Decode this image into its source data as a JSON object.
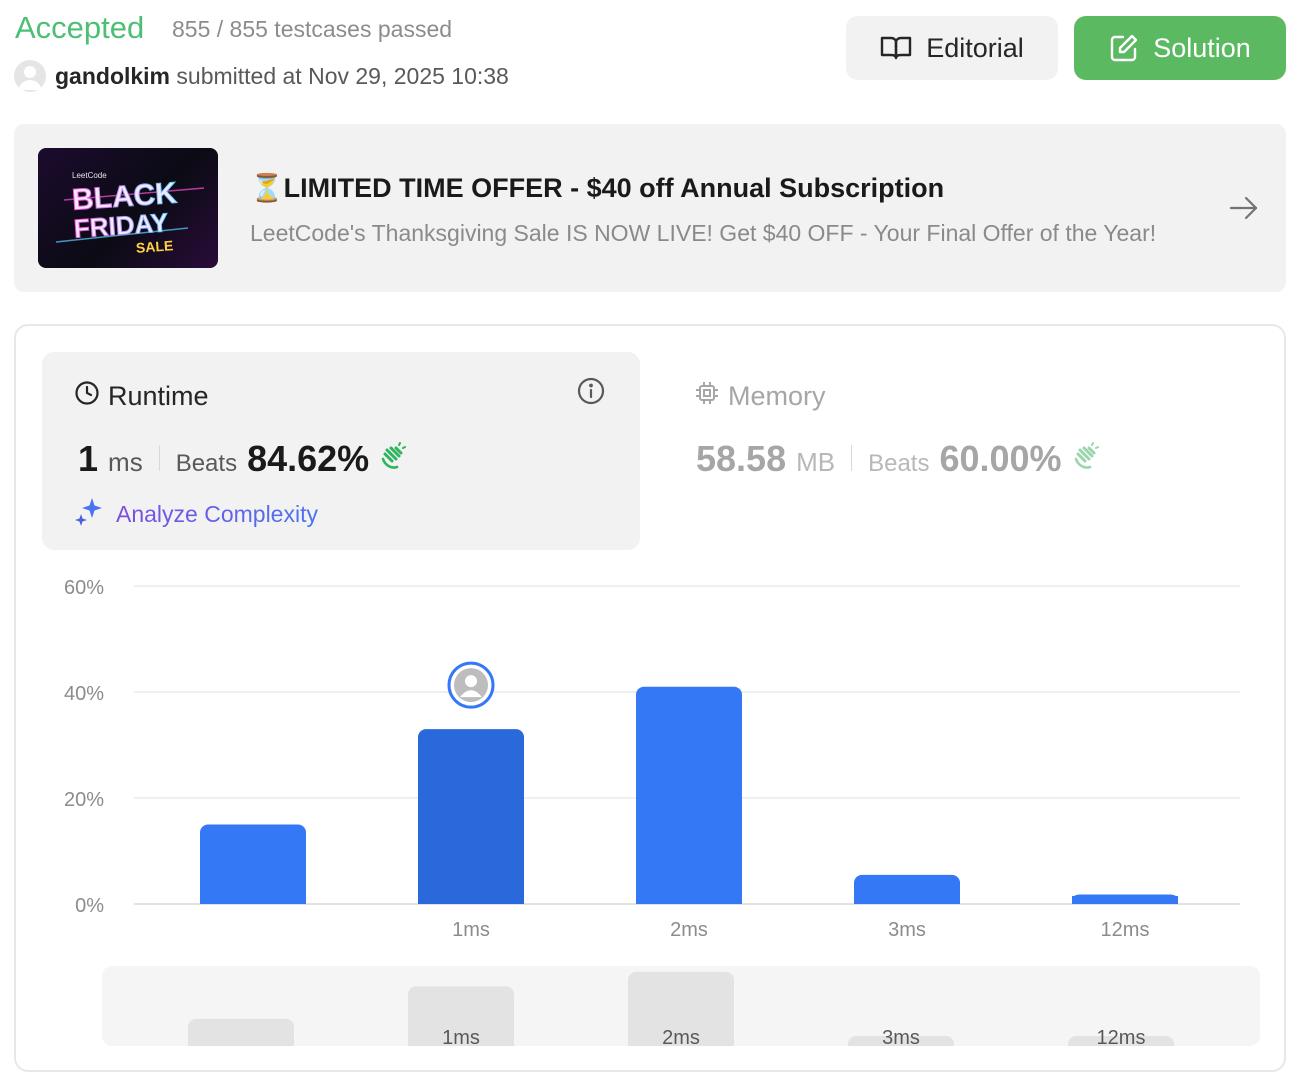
{
  "submission": {
    "status": "Accepted",
    "testcases": "855 / 855 testcases passed",
    "username": "gandolkim",
    "submitted_text": "submitted at Nov 29, 2025 10:38"
  },
  "actions": {
    "editorial_label": "Editorial",
    "solution_label": "Solution"
  },
  "promo": {
    "image_logo": "LeetCode",
    "image_line1": "BLACK",
    "image_line2": "FRIDAY",
    "image_line3": "SALE",
    "title": "⏳LIMITED TIME OFFER - $40 off Annual Subscription",
    "subtitle": "LeetCode's Thanksgiving Sale IS NOW LIVE! Get $40 OFF - Your Final Offer of the Year!"
  },
  "runtime": {
    "title": "Runtime",
    "value": "1",
    "unit": "ms",
    "beats_label": "Beats",
    "beats_pct": "84.62%",
    "analyze_label": "Analyze Complexity"
  },
  "memory": {
    "title": "Memory",
    "value": "58.58",
    "unit": "MB",
    "beats_label": "Beats",
    "beats_pct": "60.00%"
  },
  "colors": {
    "accepted": "#2db55d",
    "bar": "#3478f6",
    "bar_selected": "#2a69dc",
    "solution_button": "#5bb962"
  },
  "icons": [
    "book-icon",
    "edit-icon",
    "arrow-right-icon",
    "clock-icon",
    "info-icon",
    "chip-icon",
    "clap-icon",
    "sparkle-icon",
    "avatar-icon"
  ],
  "chart_data": {
    "type": "bar",
    "categories": [
      "",
      "1ms",
      "2ms",
      "3ms",
      "12ms"
    ],
    "values": [
      15,
      33,
      41,
      5.5,
      1.8
    ],
    "selected_index": 1,
    "ylim": [
      0,
      60
    ],
    "yticks": [
      "0%",
      "20%",
      "40%",
      "60%"
    ],
    "grid": true,
    "overview_labels": [
      "",
      "1ms",
      "2ms",
      "3ms",
      "12ms"
    ]
  }
}
